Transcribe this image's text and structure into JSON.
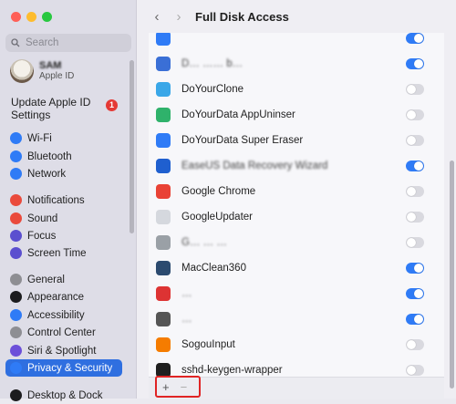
{
  "sidebar": {
    "search_placeholder": "Search",
    "profile": {
      "name": "SAM",
      "subtitle": "Apple ID"
    },
    "update": {
      "label": "Update Apple ID Settings",
      "badge": "1"
    },
    "items": [
      {
        "label": "Wi-Fi",
        "icon": "wifi-icon",
        "color": "#2f7bf6"
      },
      {
        "label": "Bluetooth",
        "icon": "bluetooth-icon",
        "color": "#2f7bf6"
      },
      {
        "label": "Network",
        "icon": "globe-icon",
        "color": "#2f7bf6"
      },
      {
        "label": "Notifications",
        "icon": "bell-icon",
        "color": "#ea4a3c"
      },
      {
        "label": "Sound",
        "icon": "speaker-icon",
        "color": "#ea4a3c"
      },
      {
        "label": "Focus",
        "icon": "moon-icon",
        "color": "#5b4fcf"
      },
      {
        "label": "Screen Time",
        "icon": "hourglass-icon",
        "color": "#5b4fcf"
      },
      {
        "label": "General",
        "icon": "gear-icon",
        "color": "#8e8e93"
      },
      {
        "label": "Appearance",
        "icon": "appearance-icon",
        "color": "#1c1c1e"
      },
      {
        "label": "Accessibility",
        "icon": "accessibility-icon",
        "color": "#2f7bf6"
      },
      {
        "label": "Control Center",
        "icon": "control-center-icon",
        "color": "#8e8e93"
      },
      {
        "label": "Siri & Spotlight",
        "icon": "siri-icon",
        "color": "#6c4fd9"
      },
      {
        "label": "Privacy & Security",
        "icon": "hand-icon",
        "color": "#2f7bf6",
        "active": true
      },
      {
        "label": "Desktop & Dock",
        "icon": "desktop-icon",
        "color": "#1c1c1e"
      }
    ]
  },
  "header": {
    "back": "‹",
    "forward": "›",
    "title": "Full Disk Access"
  },
  "apps": [
    {
      "name": "",
      "on": true,
      "color": "#2f7bf6",
      "blur": true
    },
    {
      "name": "D… …… b…",
      "on": true,
      "color": "#3a6fd6",
      "blur": true
    },
    {
      "name": "DoYourClone",
      "on": false,
      "color": "#3aa7e8"
    },
    {
      "name": "DoYourData AppUninser",
      "on": false,
      "color": "#2fb26b"
    },
    {
      "name": "DoYourData Super Eraser",
      "on": false,
      "color": "#2f7bf6"
    },
    {
      "name": "EaseUS Data Recovery Wizard",
      "on": true,
      "color": "#1f5fcf",
      "blur": true
    },
    {
      "name": "Google Chrome",
      "on": false,
      "color": "#e94235"
    },
    {
      "name": "GoogleUpdater",
      "on": false,
      "color": "#d5d8de"
    },
    {
      "name": "G… … …",
      "on": false,
      "color": "#9aa0a6",
      "blur": true
    },
    {
      "name": "MacClean360",
      "on": true,
      "color": "#2b4a6f"
    },
    {
      "name": "…",
      "on": true,
      "color": "#d33",
      "blur": true
    },
    {
      "name": "…",
      "on": true,
      "color": "#555",
      "blur": true
    },
    {
      "name": "SogouInput",
      "on": false,
      "color": "#f57c00"
    },
    {
      "name": "sshd-keygen-wrapper",
      "on": false,
      "color": "#1f1f1f"
    }
  ],
  "footer": {
    "add": "+",
    "remove": "−"
  }
}
